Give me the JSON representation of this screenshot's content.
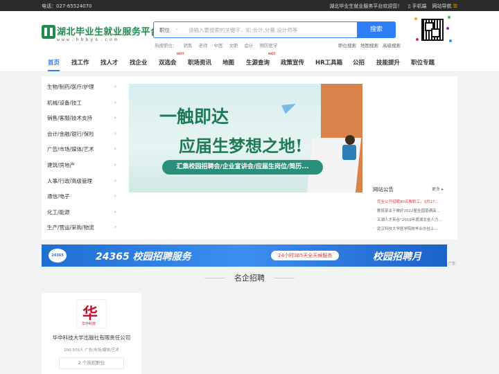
{
  "topbar": {
    "phone": "电话：027-65524070",
    "welcome": "湖北毕业生就业服务平台欢迎您！",
    "mobile": "手机端",
    "site_nav": "网站导航"
  },
  "logo": {
    "title": "湖北毕业生就业服务平台",
    "url": "www.hbbys.com"
  },
  "search": {
    "category": "职位",
    "placeholder": "请输入要搜索的关键字，如:会计,分量,设计师等",
    "button": "搜索"
  },
  "hot_label": "热搜职位：",
  "hot_items": [
    "销售",
    "老师",
    "中医",
    "文职",
    "会计",
    "预防医学"
  ],
  "header_links": [
    "职位搜索",
    "地图搜索",
    "高级搜索"
  ],
  "nav": {
    "badge": "HOT",
    "items": [
      "首页",
      "找工作",
      "找人才",
      "找企业",
      "双选会",
      "职场资讯",
      "地图",
      "生源查询",
      "政策宣传",
      "HR工具箱",
      "公招",
      "技能提升",
      "职位专题"
    ]
  },
  "categories": [
    "生物/制药/医疗/护理",
    "机械/设备/技工",
    "销售/客服/技术支持",
    "会计/金融/银行/保险",
    "广告/市场/媒体/艺术",
    "建筑/房地产",
    "人事/行政/高级管理",
    "通信/电子",
    "化工/能源",
    "生产/营运/采购/物流"
  ],
  "banner": {
    "line1": "一触即达",
    "line2": "应届生梦想之地!",
    "pill": "汇集校园招聘会/企业宣讲会/应届生岗位/简历..."
  },
  "notice": {
    "title": "网站公告",
    "more": "更多",
    "items": [
      "完全公开招聘90名教职工，3月27...",
      "教育部关于做好2022届全国普通高...",
      "五湖人才英谷“2019年度湖北省人力...",
      "武汉科技大学医学院校毕业办挂上..."
    ]
  },
  "ad": {
    "logo": "24365",
    "text1": "24365 校园招聘服务",
    "text2": "24小时365天全天候服务",
    "text3": "校园招聘月",
    "tag": "广告"
  },
  "section_title": "名企招聘",
  "companies": [
    {
      "logo_glyph": "华",
      "logo_sub": "华中科技",
      "name": "华中科技大学出版社有限责任公司",
      "meta": "200-500人  广告/市场/媒体/艺术",
      "jobs_count": "2",
      "jobs_label": "个热招职位"
    }
  ],
  "colors": {
    "accent": "#2d7ef7",
    "brand": "#1e8c4e",
    "hot": "#e4393c"
  }
}
